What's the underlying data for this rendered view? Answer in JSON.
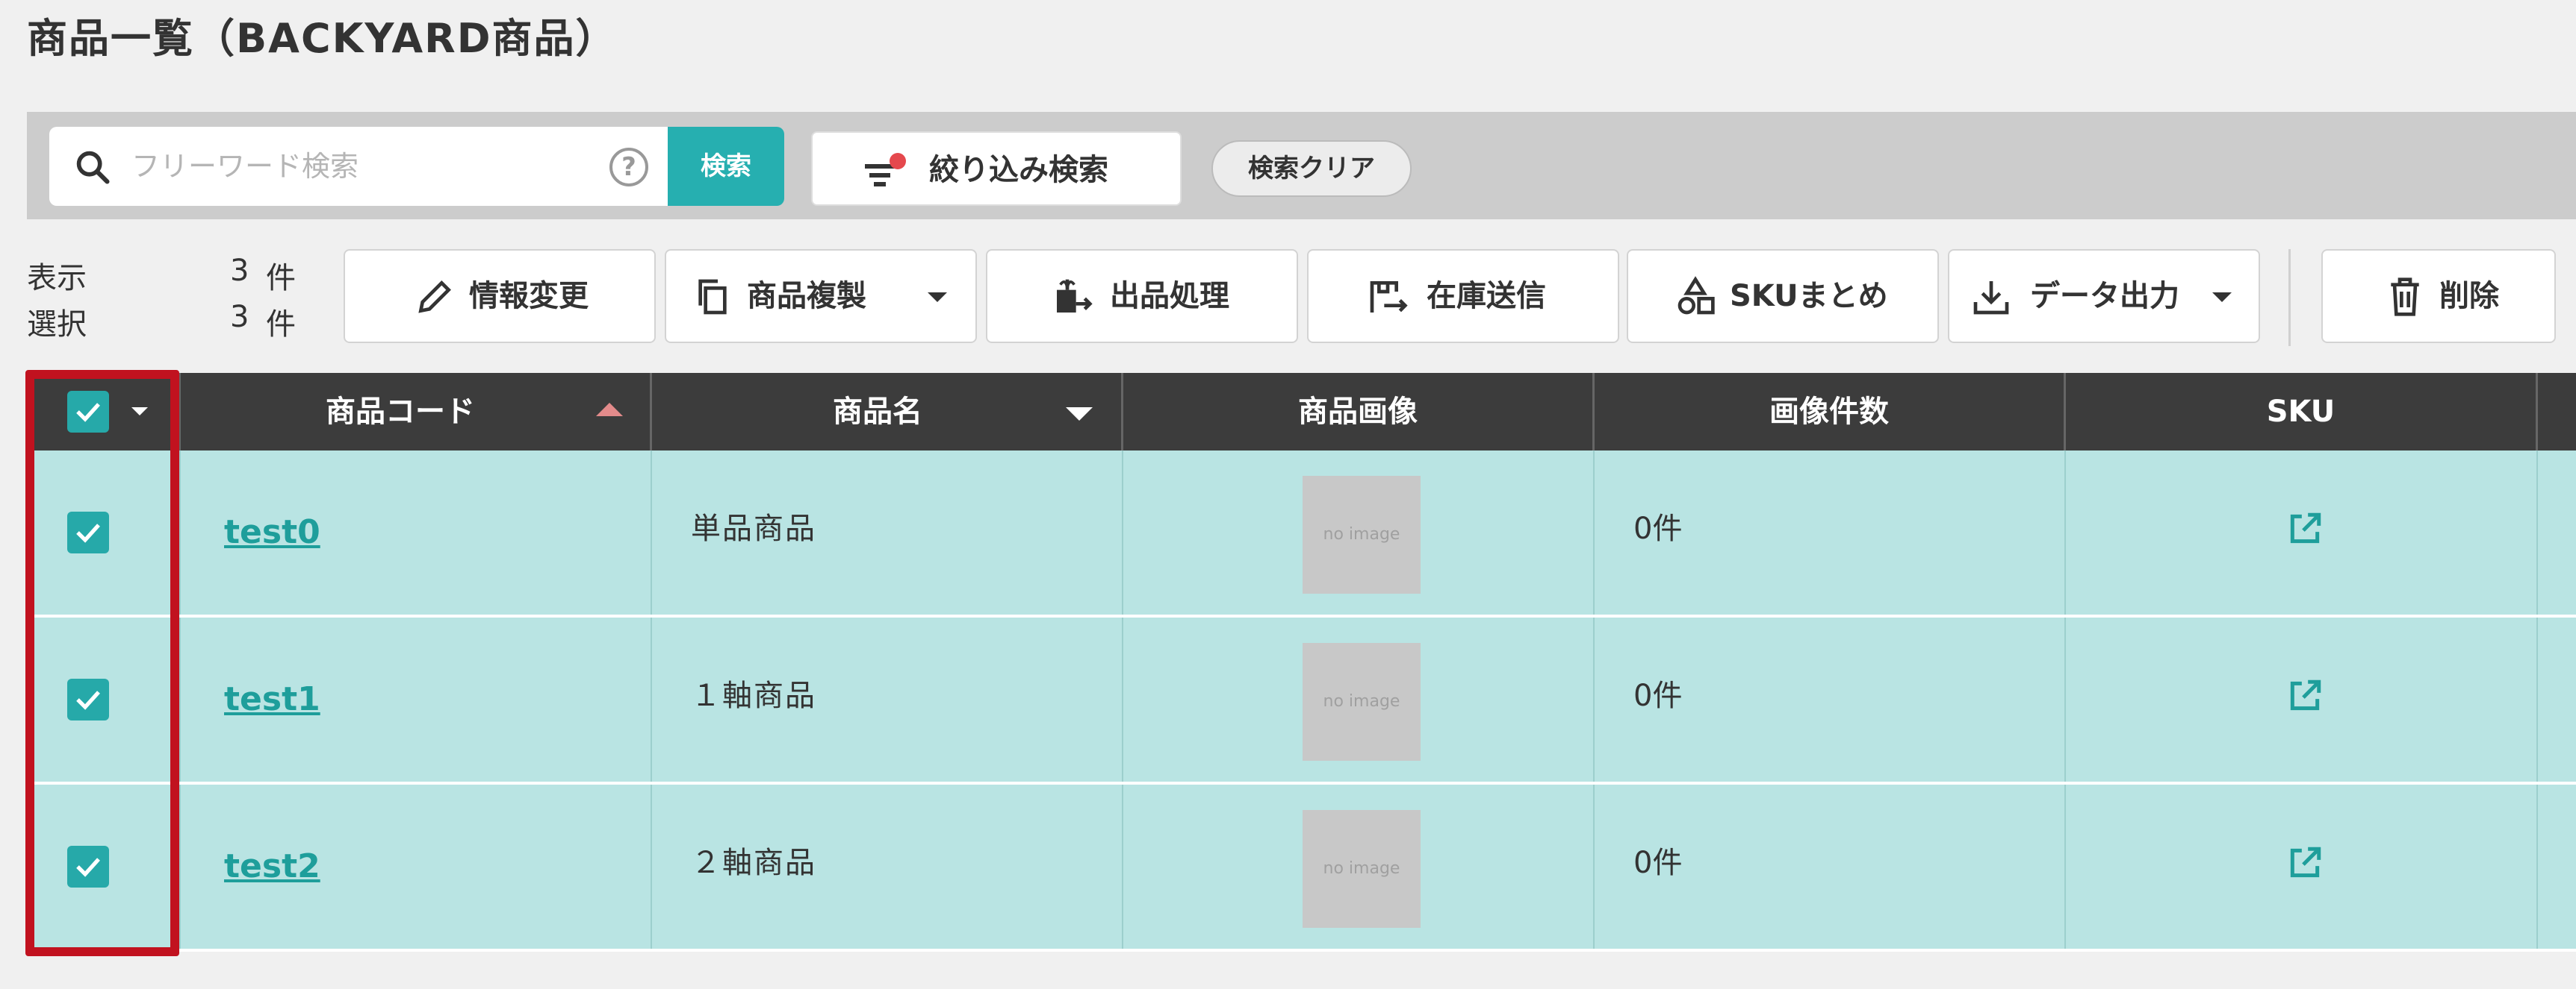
{
  "page": {
    "title": "商品一覧（BACKYARD商品）"
  },
  "search": {
    "placeholder": "フリーワード検索",
    "help_symbol": "?",
    "button_label": "検索",
    "filter_label": "絞り込み検索",
    "clear_label": "検索クリア",
    "accent_color": "#26afb0",
    "filter_badge_color": "#e5484d"
  },
  "counts": {
    "display_label": "表示",
    "display_value": "3",
    "display_unit": "件",
    "selected_label": "選択",
    "selected_value": "3",
    "selected_unit": "件"
  },
  "toolbar": {
    "edit_label": "情報変更",
    "duplicate_label": "商品複製",
    "listing_label": "出品処理",
    "stock_label": "在庫送信",
    "sku_label": "SKUまとめ",
    "export_label": "データ出力",
    "delete_label": "削除"
  },
  "table": {
    "headers": {
      "code": "商品コード",
      "name": "商品名",
      "image": "商品画像",
      "image_count": "画像件数",
      "sku": "SKU"
    },
    "sort": {
      "code": "ascending",
      "name": "descending"
    },
    "header_bg": "#3c3c3c",
    "row_bg": "#b9e4e3",
    "rows": [
      {
        "checked": true,
        "code": "test0",
        "name": "単品商品",
        "image": "no image",
        "image_count": "0件"
      },
      {
        "checked": true,
        "code": "test1",
        "name": "１軸商品",
        "image": "no image",
        "image_count": "0件"
      },
      {
        "checked": true,
        "code": "test2",
        "name": "２軸商品",
        "image": "no image",
        "image_count": "0件"
      }
    ]
  },
  "highlight": {
    "color": "#c1121f"
  }
}
